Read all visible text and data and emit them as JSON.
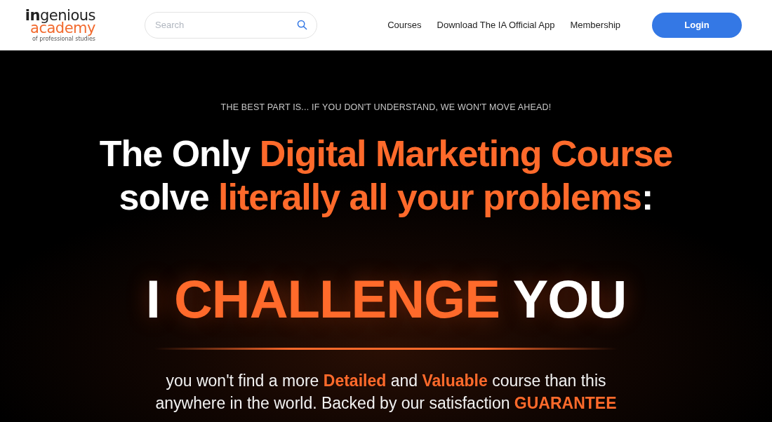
{
  "header": {
    "logo": {
      "bold_part": "in",
      "rest": "genious",
      "sub": "academy",
      "tagline": "of professional studies"
    },
    "search": {
      "placeholder": "Search"
    },
    "nav": [
      "Courses",
      "Download The IA Official App",
      "Membership"
    ],
    "login": "Login"
  },
  "hero": {
    "eyebrow": "THE BEST PART IS... IF YOU DON'T UNDERSTAND, WE WON'T MOVE AHEAD!",
    "headline_lines": [
      "The Only **Digital Marketing Course**",
      "solve **literally all your problems**:"
    ],
    "challenge": "I **CHALLENGE** YOU",
    "body": "you won't find a more **Detailed** and **Valuable** course than this anywhere in the world. Backed by our satisfaction **GUARANTEE**"
  }
}
